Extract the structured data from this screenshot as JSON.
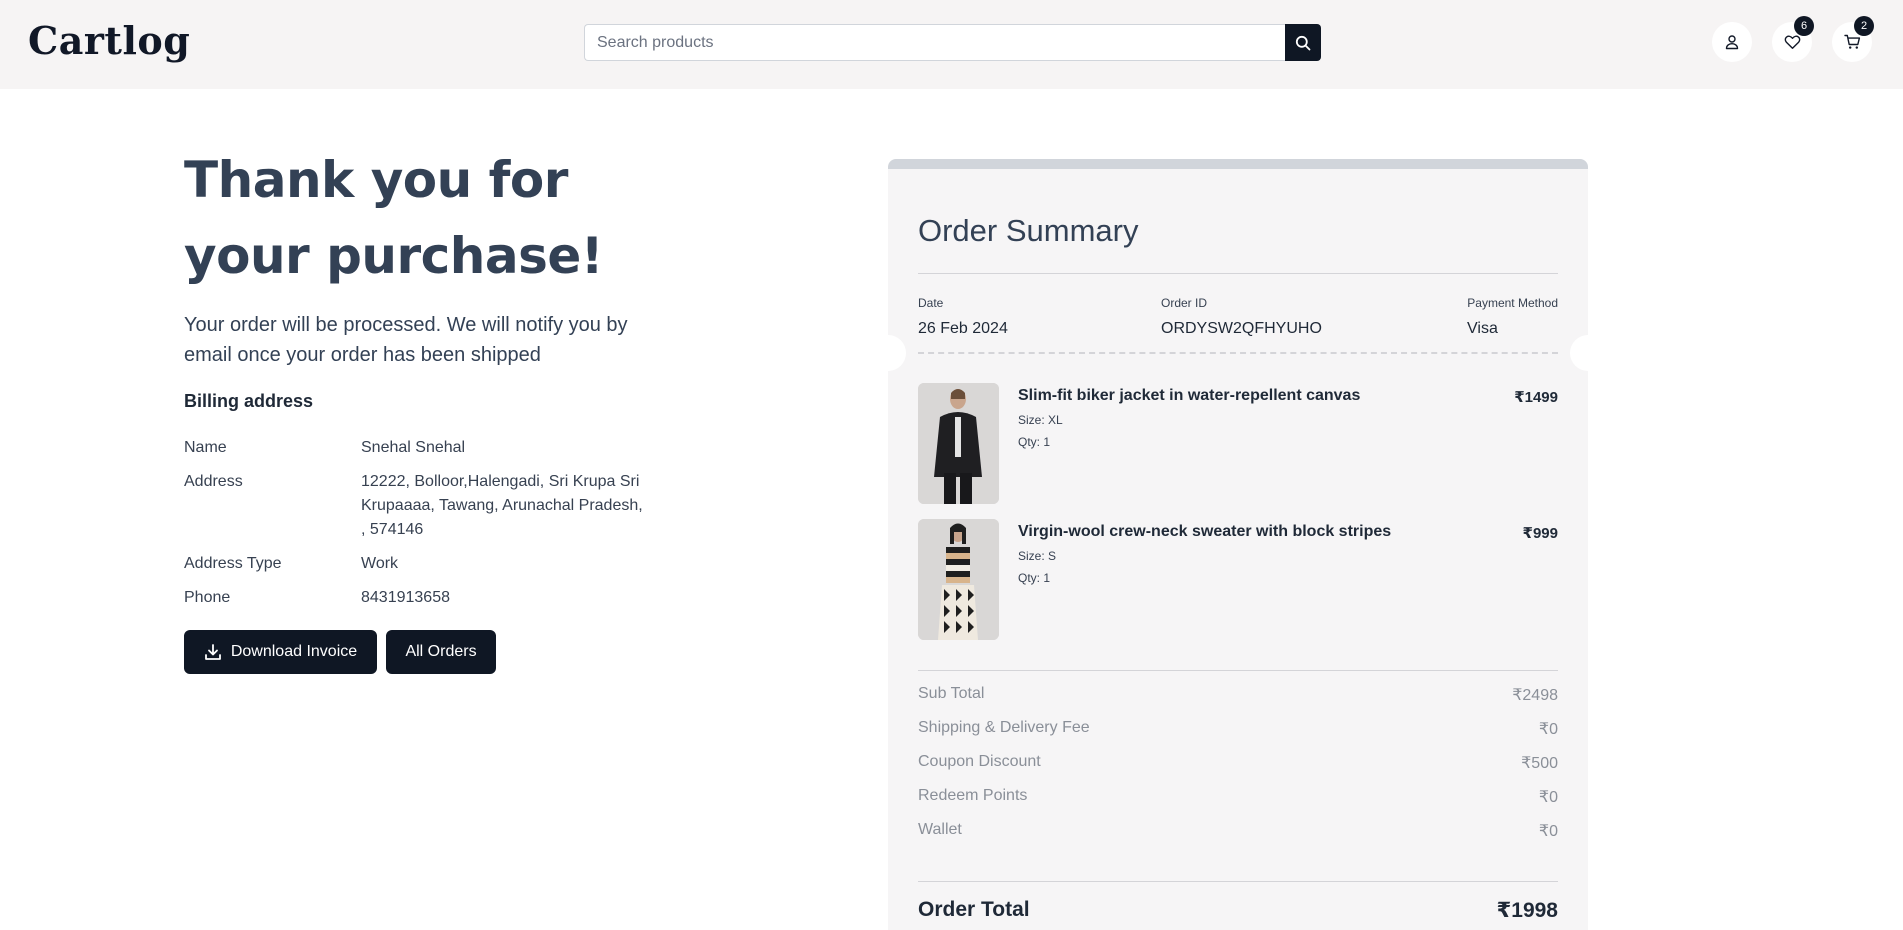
{
  "header": {
    "logo": "Cartlog",
    "search_placeholder": "Search products",
    "wishlist_count": "6",
    "cart_count": "2"
  },
  "left": {
    "heading_line1": "Thank you for",
    "heading_line2": "your purchase!",
    "notify": "Your order will be processed. We will notify you by email once your order has been shipped",
    "billing_title": "Billing address",
    "billing": [
      {
        "label": "Name",
        "value": "Snehal Snehal"
      },
      {
        "label": "Address",
        "value": "12222, Bolloor,Halengadi, Sri Krupa Sri Krupaaaa, Tawang, Arunachal Pradesh, , 574146"
      },
      {
        "label": "Address Type",
        "value": "Work"
      },
      {
        "label": "Phone",
        "value": "8431913658"
      }
    ],
    "download_label": "Download Invoice",
    "all_orders_label": "All Orders"
  },
  "summary": {
    "title": "Order Summary",
    "date_label": "Date",
    "date": "26 Feb 2024",
    "order_id_label": "Order ID",
    "order_id": "ORDYSW2QFHYUHO",
    "payment_label": "Payment Method",
    "payment": "Visa",
    "items": [
      {
        "name": "Slim-fit biker jacket in water-repellent canvas",
        "size": "Size: XL",
        "qty": "Qty: 1",
        "price": "₹1499"
      },
      {
        "name": "Virgin-wool crew-neck sweater with block stripes",
        "size": "Size: S",
        "qty": "Qty: 1",
        "price": "₹999"
      }
    ],
    "rows": [
      {
        "label": "Sub Total",
        "value": "₹2498"
      },
      {
        "label": "Shipping & Delivery Fee",
        "value": "₹0"
      },
      {
        "label": "Coupon Discount",
        "value": "₹500"
      },
      {
        "label": "Redeem Points",
        "value": "₹0"
      },
      {
        "label": "Wallet",
        "value": "₹0"
      }
    ],
    "total_label": "Order Total",
    "total_value": "₹1998"
  }
}
